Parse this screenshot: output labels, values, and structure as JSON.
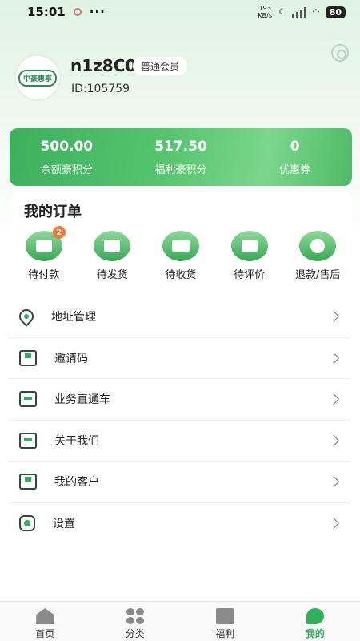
{
  "status_bar": {
    "time": "15:01",
    "more": "···",
    "net_speed_value": "193",
    "net_speed_unit": "KB/s",
    "battery": "80"
  },
  "profile": {
    "avatar_text": "中豪惠享",
    "username": "n1z8C0",
    "member_level": "普通会员",
    "user_id": "ID:105759"
  },
  "points": [
    {
      "value": "500.00",
      "label": "余额豪积分"
    },
    {
      "value": "517.50",
      "label": "福利豪积分"
    },
    {
      "value": "0",
      "label": "优惠券"
    }
  ],
  "orders": {
    "title": "我的订单",
    "items": [
      {
        "label": "待付款",
        "badge": "2",
        "icon": "wallet-icon"
      },
      {
        "label": "待发货",
        "badge": "",
        "icon": "clipboard-clock-icon"
      },
      {
        "label": "待收货",
        "badge": "",
        "icon": "truck-icon"
      },
      {
        "label": "待评价",
        "badge": "",
        "icon": "edit-note-icon"
      },
      {
        "label": "退款/售后",
        "badge": "",
        "icon": "refund-icon"
      }
    ]
  },
  "menu": [
    {
      "label": "地址管理",
      "icon": "location-pin-icon"
    },
    {
      "label": "邀请码",
      "icon": "mail-icon"
    },
    {
      "label": "业务直通车",
      "icon": "box-icon"
    },
    {
      "label": "关于我们",
      "icon": "box-icon"
    },
    {
      "label": "我的客户",
      "icon": "mail-icon"
    },
    {
      "label": "设置",
      "icon": "settings-icon"
    }
  ],
  "tabbar": [
    {
      "label": "首页",
      "icon": "home-icon",
      "active": false
    },
    {
      "label": "分类",
      "icon": "category-icon",
      "active": false
    },
    {
      "label": "福利",
      "icon": "gift-icon",
      "active": false
    },
    {
      "label": "我的",
      "icon": "profile-icon",
      "active": true
    }
  ],
  "colors": {
    "accent": "#2fb05a",
    "badge": "#f07a3a"
  }
}
